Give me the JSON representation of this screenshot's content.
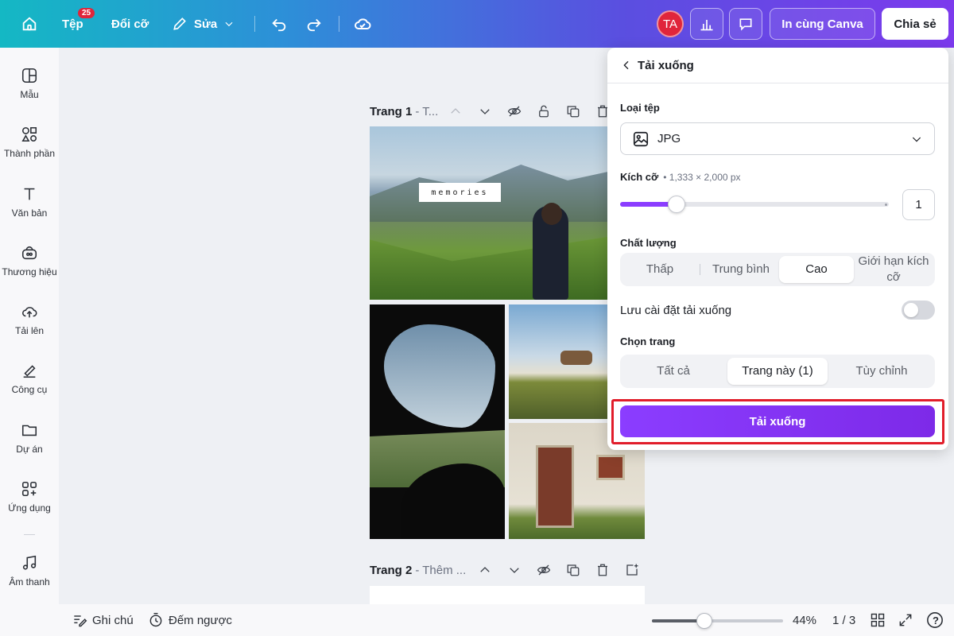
{
  "topbar": {
    "file_label": "Tệp",
    "file_badge": "25",
    "resize_label": "Đổi cỡ",
    "edit_label": "Sửa",
    "avatar_initials": "TA",
    "print_label": "In cùng Canva",
    "share_label": "Chia sẻ",
    "gradient_start": "#14b8c4",
    "gradient_end": "#7c3aed"
  },
  "sidebar": {
    "items": [
      {
        "label": "Mẫu",
        "icon": "template-icon"
      },
      {
        "label": "Thành phần",
        "icon": "elements-icon"
      },
      {
        "label": "Văn bản",
        "icon": "text-icon"
      },
      {
        "label": "Thương hiệu",
        "icon": "brand-icon"
      },
      {
        "label": "Tải lên",
        "icon": "upload-icon"
      },
      {
        "label": "Công cụ",
        "icon": "tools-icon"
      },
      {
        "label": "Dự án",
        "icon": "folder-icon"
      },
      {
        "label": "Ứng dụng",
        "icon": "apps-icon"
      },
      {
        "label": "Âm thanh",
        "icon": "music-icon"
      }
    ]
  },
  "canvas": {
    "page1_title": "Trang 1",
    "page1_sub": "- T...",
    "page2_title": "Trang 2",
    "page2_sub": "- Thêm ...",
    "memories_text": "memories"
  },
  "panel": {
    "title": "Tải xuống",
    "file_type_label": "Loại tệp",
    "file_type_value": "JPG",
    "size_label": "Kích cỡ",
    "size_meta": "• 1,333 × 2,000 px",
    "size_value": "1",
    "size_slider_fraction": 0.21,
    "quality_label": "Chất lượng",
    "quality_options": [
      "Thấp",
      "Trung bình",
      "Cao",
      "Giới hạn kích cỡ"
    ],
    "quality_selected": "Cao",
    "save_settings_label": "Lưu cài đặt tải xuống",
    "save_settings_on": false,
    "pages_label": "Chọn trang",
    "pages_options": [
      "Tất cả",
      "Trang này (1)",
      "Tùy chỉnh"
    ],
    "pages_selected": "Trang này (1)",
    "download_button": "Tải xuống",
    "accent_color": "#8b3dff",
    "highlight_color": "#e11d2a"
  },
  "bottombar": {
    "notes_label": "Ghi chú",
    "timer_label": "Đếm ngược",
    "zoom": "44%",
    "zoom_fraction": 0.4,
    "page_counter": "1 / 3",
    "help": "?"
  }
}
